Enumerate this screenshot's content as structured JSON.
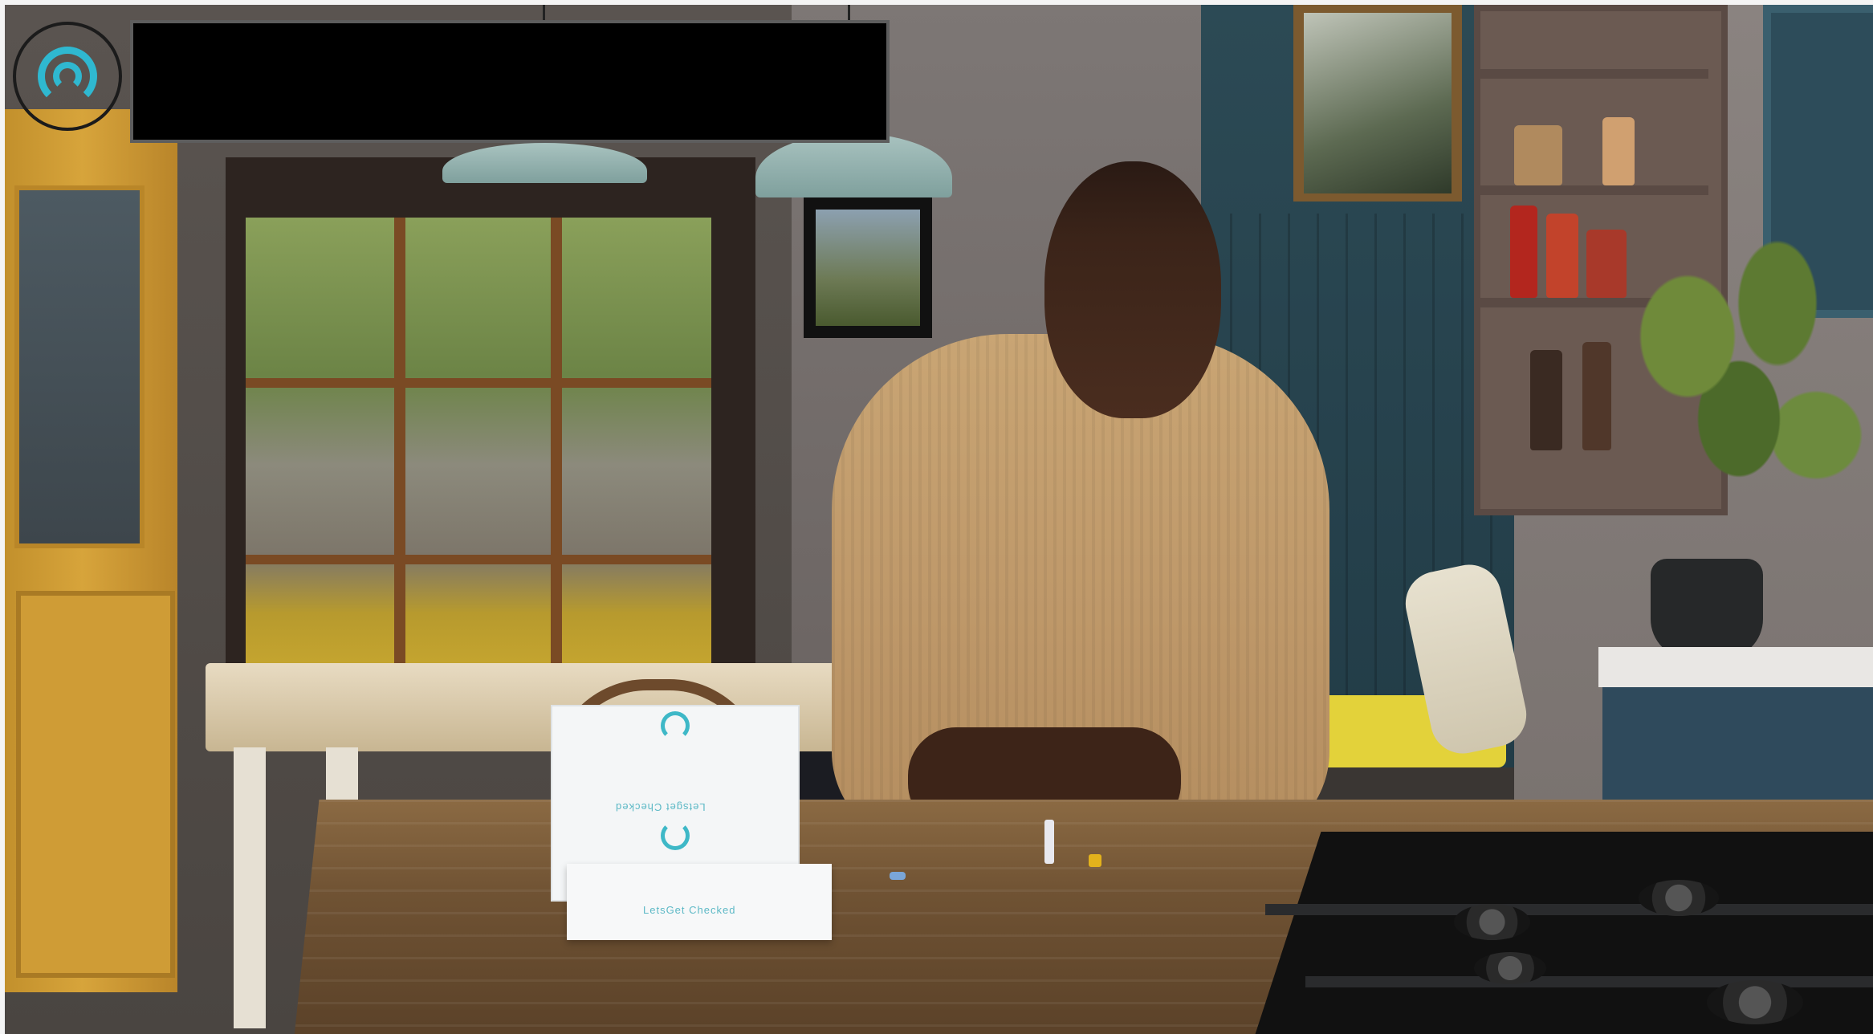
{
  "video": {
    "description_label": "",
    "box_text_top": "Letsget Checked",
    "box_text_bottom": "LetsGet Checked"
  },
  "overlay": {
    "brand_icon": "signal-ring-icon",
    "redaction_text": ""
  },
  "colors": {
    "brand_teal": "#2fb8d0",
    "redaction": "#000000"
  }
}
